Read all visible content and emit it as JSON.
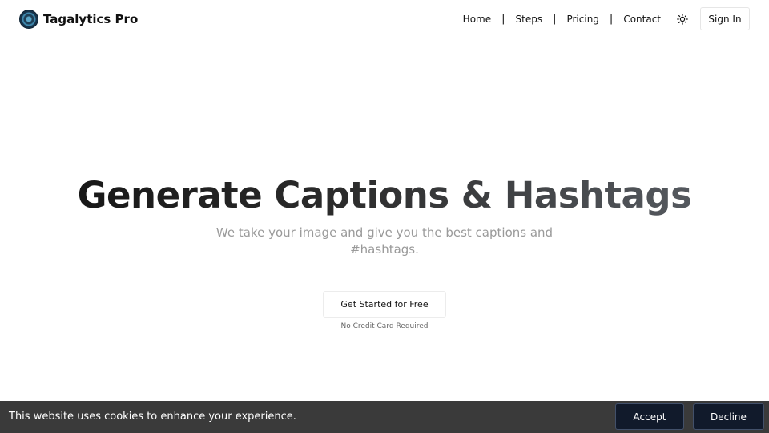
{
  "header": {
    "brand": "Tagalytics Pro",
    "nav": [
      "Home",
      "Steps",
      "Pricing",
      "Contact"
    ],
    "separator": "|",
    "theme_icon": "sun-icon",
    "signin_label": "Sign In"
  },
  "hero": {
    "title": "Generate Captions & Hashtags",
    "subtitle": "We take your image and give you the best captions and #hashtags.",
    "cta_label": "Get Started for Free",
    "cta_note": "No Credit Card Required"
  },
  "cookie": {
    "text": "This website uses cookies to enhance your experience.",
    "accept_label": "Accept",
    "decline_label": "Decline"
  },
  "colors": {
    "cookie_bar": "#3a3a3a",
    "cookie_button": "#111a2b",
    "subtitle": "#9a9a9a"
  }
}
